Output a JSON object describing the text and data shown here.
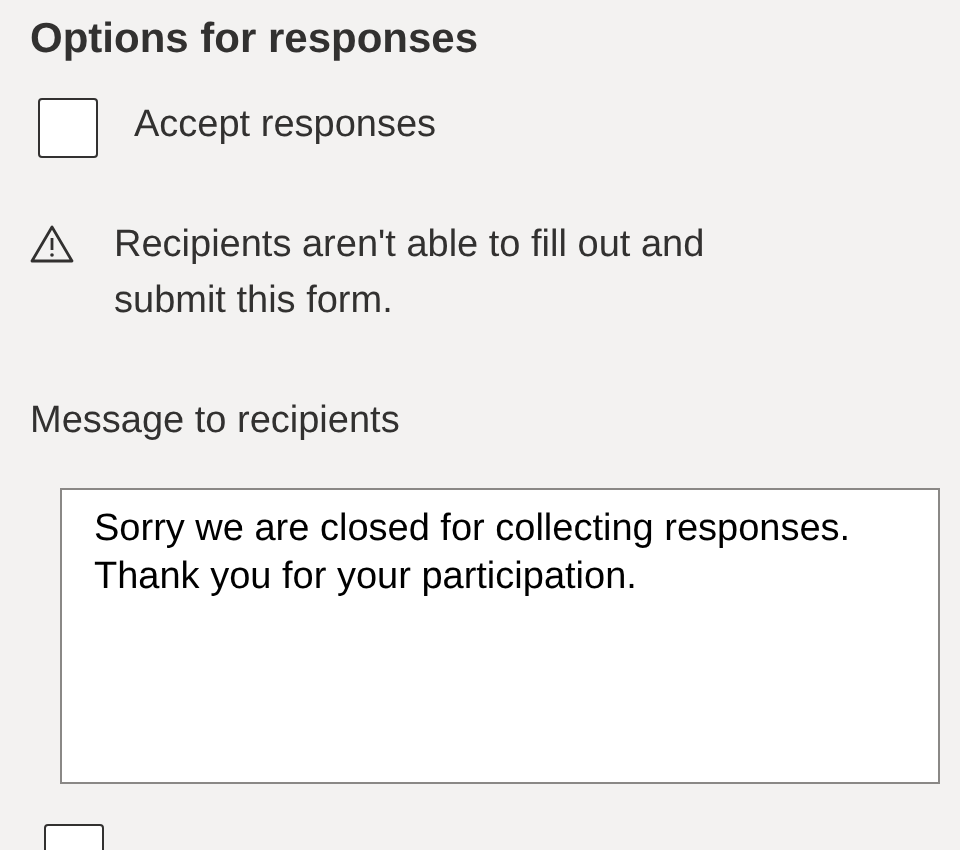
{
  "section": {
    "title": "Options for responses"
  },
  "accept": {
    "label": "Accept responses",
    "checked": false
  },
  "warning": {
    "text": "Recipients aren't able to fill out and submit this form."
  },
  "message": {
    "label": "Message to recipients",
    "value": "Sorry we are closed for collecting responses. Thank you for your participation."
  },
  "next_option": {
    "checked": false
  }
}
